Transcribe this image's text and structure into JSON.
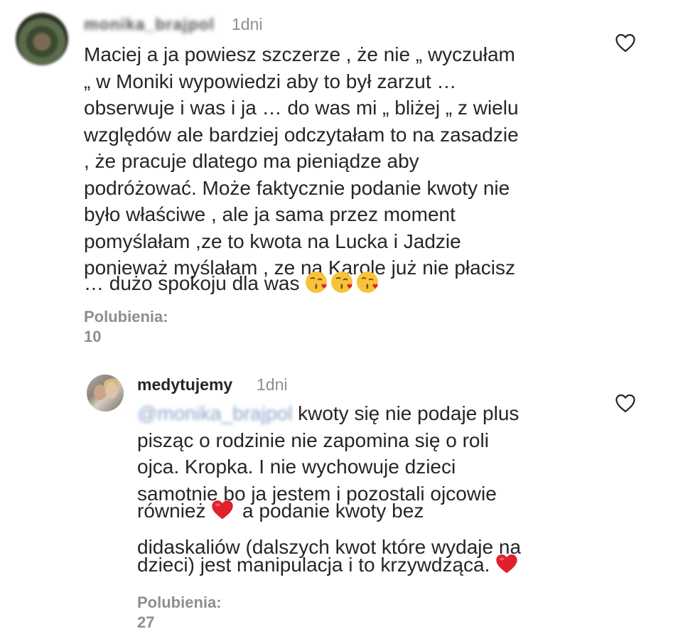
{
  "comments": [
    {
      "username": "monika_brajpol",
      "time": "1dni",
      "lines": [
        "Maciej a ja powiesz szczerze , że nie „ wyczułam",
        "„ w Moniki wypowiedzi aby to był zarzut …",
        "obserwuje i was i ja … do was mi „ bliżej „ z wielu",
        "względów ale bardziej odczytałam to na zasadzie",
        ", że pracuje dlatego ma pieniądze aby",
        "podróżować. Może faktycznie podanie kwoty nie",
        "było właściwe , ale ja sama przez moment",
        "pomyślałam ,ze to kwota na Lucka i Jadzie",
        "ponieważ myślałam , ze na Karole już nie płacisz",
        "… dużo spokoju dla was"
      ],
      "emojis": [
        "kissing-heart-emoji",
        "kissing-heart-emoji",
        "kissing-heart-emoji"
      ],
      "likes": "Polubienia: 10"
    },
    {
      "username": "medytujemy",
      "time": "1dni",
      "mention": "@monika_brajpol",
      "lines": [
        "kwoty się nie podaje plus",
        "pisząc o rodzinie nie zapomina się o roli",
        "ojca. Kropka. I nie wychowuje dzieci",
        "samotnie bo ja jestem i pozostali ojcowie",
        "również",
        "a podanie kwoty bez",
        "didaskaliów (dalszych kwot które wydaje na",
        "dzieci) jest manipulacja i to krzywdząca."
      ],
      "emojis": [
        "red-heart-emoji",
        "red-heart-emoji"
      ],
      "likes": "Polubienia: 27"
    }
  ],
  "colors": {
    "text": "#262626",
    "muted": "#8e8e8e",
    "heart": "#e0202b"
  }
}
